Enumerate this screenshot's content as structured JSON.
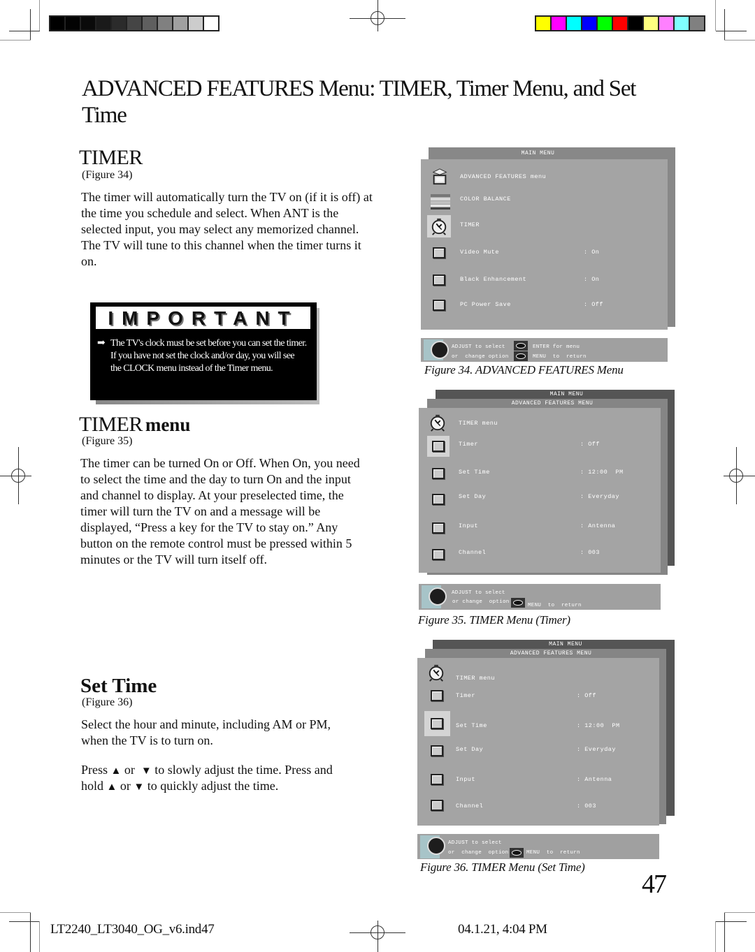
{
  "color_bars": {
    "grayscale": [
      "#000000",
      "#030303",
      "#0a0a0a",
      "#1a1a1a",
      "#2b2b2b",
      "#454545",
      "#5f5f5f",
      "#808080",
      "#a0a0a0",
      "#cccccc",
      "#ffffff"
    ],
    "colors": [
      "#ffff00",
      "#ff00ff",
      "#00ffff",
      "#0000ff",
      "#00ff00",
      "#ff0000",
      "#000000",
      "#ffff80",
      "#ff80ff",
      "#80ffff",
      "#808080"
    ]
  },
  "page_title": "ADVANCED FEATURES Menu: TIMER, Timer Menu, and Set Time",
  "sections": {
    "timer": {
      "heading": "TIMER",
      "figure_ref": "(Figure 34)",
      "body": "The timer will automatically turn the TV on (if it is off) at the time you schedule and select.  When ANT is the selected input, you may select any memorized channel.  The TV will tune to this channel when the timer turns it on."
    },
    "important": {
      "heading": "IMPORTANT",
      "arrow": "➡",
      "body": "The TV's clock must be set before you can set the timer.  If you have not set the clock and/or day, you will see the CLOCK menu instead of the Timer menu."
    },
    "timer_menu": {
      "heading_main": "TIMER",
      "heading_sub": "menu",
      "figure_ref": "(Figure 35)",
      "body": "The timer can be turned On or Off.  When On, you need to select the time and the day to turn On and the input and channel to display.  At your preselected time, the timer will turn the TV on and a message will be displayed, “Press a key for the TV to stay on.” Any button on the remote control must be pressed within 5 minutes or the TV will turn itself off."
    },
    "set_time": {
      "heading": "Set Time",
      "figure_ref": "(Figure 36)",
      "body1": "Select the hour and minute, including AM or PM, when the TV is to turn on.",
      "body2_a": "Press",
      "up": "▲",
      "or1": "or",
      "down": "▼",
      "body2_b": "to slowly adjust the time.  Press and",
      "body3_a": "hold",
      "or2": "or",
      "body3_b": "to quickly adjust the time."
    }
  },
  "figure34": {
    "title": "MAIN MENU",
    "rows": [
      {
        "icon": "graduation-cap-tv-icon",
        "label": "ADVANCED FEATURES menu",
        "value": ""
      },
      {
        "icon": "color-balance-icon",
        "label": "COLOR BALANCE",
        "value": ""
      },
      {
        "icon": "alarm-clock-icon",
        "label": "TIMER",
        "value": ""
      },
      {
        "icon": "square-icon",
        "label": "Video Mute",
        "value": ": On"
      },
      {
        "icon": "square-icon",
        "label": "Black Enhancement",
        "value": ": On"
      },
      {
        "icon": "square-icon",
        "label": "PC Power Save",
        "value": ": Off"
      }
    ],
    "help": {
      "line1a": "ADJUST to select",
      "line1b": "ENTER for menu",
      "line2a": "or  change option",
      "line2b": "MENU  to  return"
    },
    "caption": "Figure 34.  ADVANCED FEATURES Menu"
  },
  "figure35": {
    "title1": "MAIN MENU",
    "title2": "ADVANCED FEATURES MENU",
    "header": "TIMER menu",
    "rows": [
      {
        "label": "Timer",
        "value": ": Off"
      },
      {
        "label": "Set Time",
        "value": ": 12:00  PM"
      },
      {
        "label": "Set Day",
        "value": ": Everyday"
      },
      {
        "label": "Input",
        "value": ": Antenna"
      },
      {
        "label": "Channel",
        "value": ": 003"
      }
    ],
    "help": {
      "line1": "ADJUST to select",
      "line2": "or change  option",
      "line3": "MENU  to  return"
    },
    "caption": "Figure  35.  TIMER Menu (Timer)"
  },
  "figure36": {
    "title1": "MAIN MENU",
    "title2": "ADVANCED FEATURES MENU",
    "header": "TIMER menu",
    "rows": [
      {
        "label": "Timer",
        "value": ": Off"
      },
      {
        "label": "Set Time",
        "value": ": 12:00  PM"
      },
      {
        "label": "Set Day",
        "value": ": Everyday"
      },
      {
        "label": "Input",
        "value": ": Antenna"
      },
      {
        "label": "Channel",
        "value": ": 003"
      }
    ],
    "help": {
      "line1": "ADJUST to select",
      "line2": "or  change  option",
      "line3": "MENU  to  return"
    },
    "caption": "Figure  36.  TIMER Menu (Set Time)"
  },
  "page_number": "47",
  "footer": {
    "filename": "LT2240_LT3040_OG_v6.ind47",
    "datetime": "04.1.21, 4:04 PM"
  }
}
